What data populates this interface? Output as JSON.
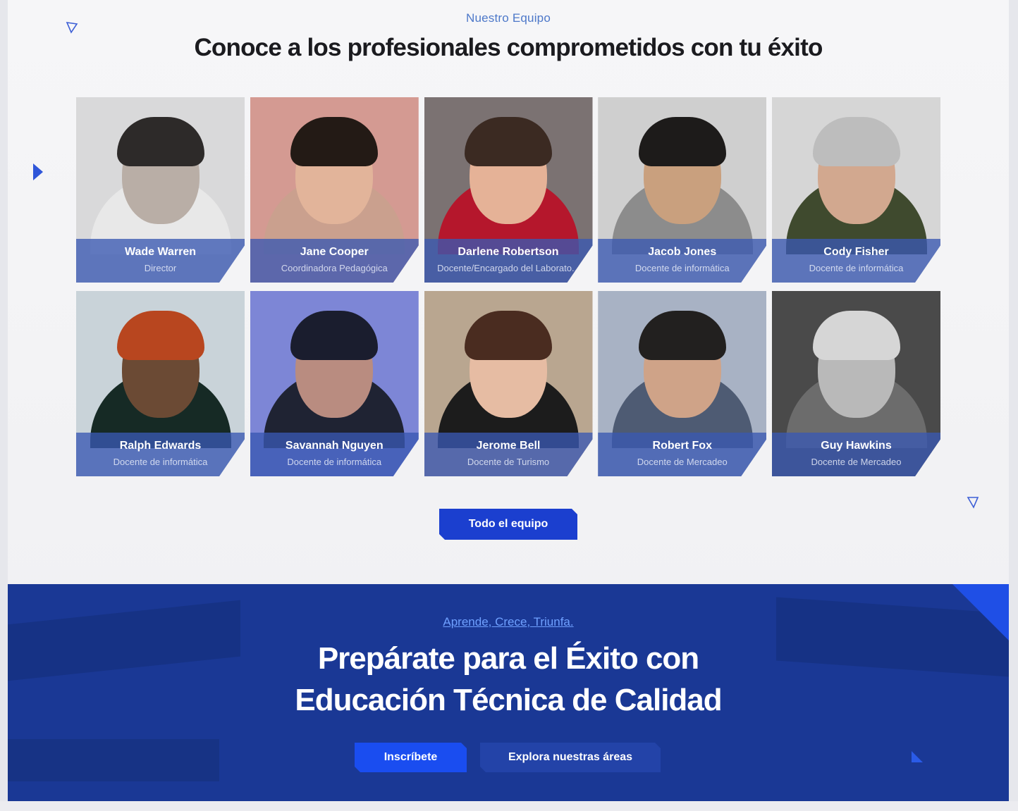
{
  "team": {
    "eyebrow": "Nuestro Equipo",
    "title": "Conoce a los profesionales comprometidos con tu éxito",
    "members": [
      {
        "name": "Wade Warren",
        "role": "Director",
        "bg": "#d9d9da",
        "skin": "#b9aea6",
        "hair": "#2d2a29",
        "shirt": "#e8e8e8"
      },
      {
        "name": "Jane Cooper",
        "role": "Coordinadora Pedagógica",
        "bg": "#d49a92",
        "skin": "#e2b49a",
        "hair": "#231a15",
        "shirt": "#caa08e"
      },
      {
        "name": "Darlene Robertson",
        "role": "Docente/Encargado del Laborato...",
        "bg": "#7b7272",
        "skin": "#e5b297",
        "hair": "#3b2a22",
        "shirt": "#b5172c"
      },
      {
        "name": "Jacob Jones",
        "role": "Docente de informática",
        "bg": "#cfcfcf",
        "skin": "#c9a07e",
        "hair": "#1d1b1a",
        "shirt": "#8c8c8c"
      },
      {
        "name": "Cody Fisher",
        "role": "Docente de informática",
        "bg": "#d6d6d6",
        "skin": "#d2a88f",
        "hair": "#bdbdbd",
        "shirt": "#3f4a2e"
      },
      {
        "name": "Ralph Edwards",
        "role": "Docente de informática",
        "bg": "#c9d3d9",
        "skin": "#6b4a34",
        "hair": "#b8461f",
        "shirt": "#162a25"
      },
      {
        "name": "Savannah Nguyen",
        "role": "Docente de informática",
        "bg": "#7d86d6",
        "skin": "#b98c80",
        "hair": "#1a1d2e",
        "shirt": "#1f2333"
      },
      {
        "name": "Jerome Bell",
        "role": "Docente de Turismo",
        "bg": "#b9a690",
        "skin": "#e6bca3",
        "hair": "#4a2c20",
        "shirt": "#1c1c1c"
      },
      {
        "name": "Robert Fox",
        "role": "Docente de Mercadeo",
        "bg": "#a8b2c4",
        "skin": "#cfa388",
        "hair": "#22201f",
        "shirt": "#4e5b73"
      },
      {
        "name": "Guy Hawkins",
        "role": "Docente de Mercadeo",
        "bg": "#4a4a4a",
        "skin": "#b9b9b9",
        "hair": "#d6d6d6",
        "shirt": "#6c6c6c"
      }
    ],
    "button_label": "Todo el equipo"
  },
  "cta": {
    "eyebrow": "Aprende, Crece, Triunfa.",
    "title_line1": "Prepárate para el Éxito con",
    "title_line2": "Educación Técnica de Calidad",
    "primary_label": "Inscríbete",
    "secondary_label": "Explora nuestras áreas"
  },
  "colors": {
    "accent": "#1b3fcf",
    "cta_bg": "#1a3895",
    "caption_overlay": "rgba(58,88,178,0.78)"
  }
}
